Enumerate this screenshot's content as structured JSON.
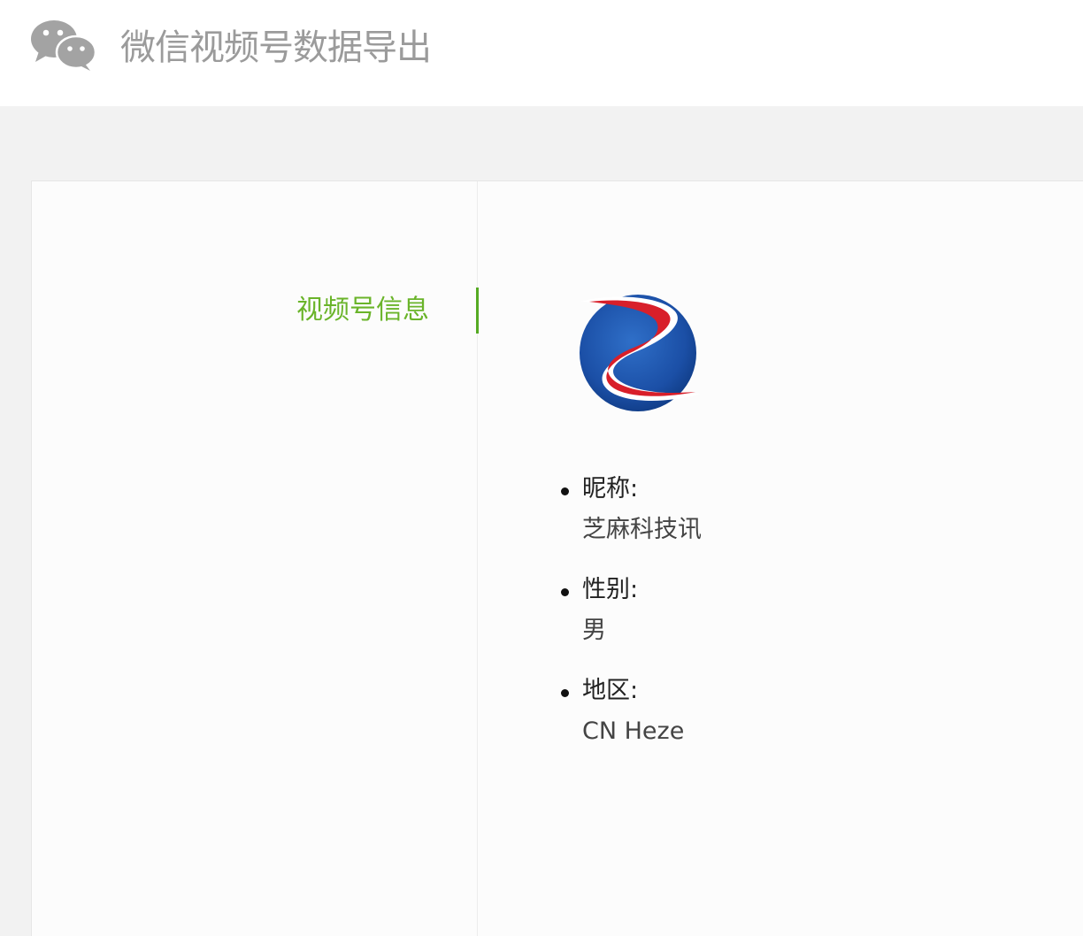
{
  "header": {
    "logo_icon": "wechat-icon",
    "title": "微信视频号数据导出"
  },
  "sidebar": {
    "items": [
      {
        "label": "视频号信息",
        "active": true
      }
    ]
  },
  "profile": {
    "avatar_icon": "channel-logo-z",
    "fields": [
      {
        "key": "昵称:",
        "value": "芝麻科技讯"
      },
      {
        "key": "性别:",
        "value": "男"
      },
      {
        "key": "地区:",
        "value": "CN Heze"
      }
    ]
  },
  "colors": {
    "accent_green": "#6ab42a",
    "title_gray": "#9b9b9b",
    "background": "#f2f2f2"
  }
}
